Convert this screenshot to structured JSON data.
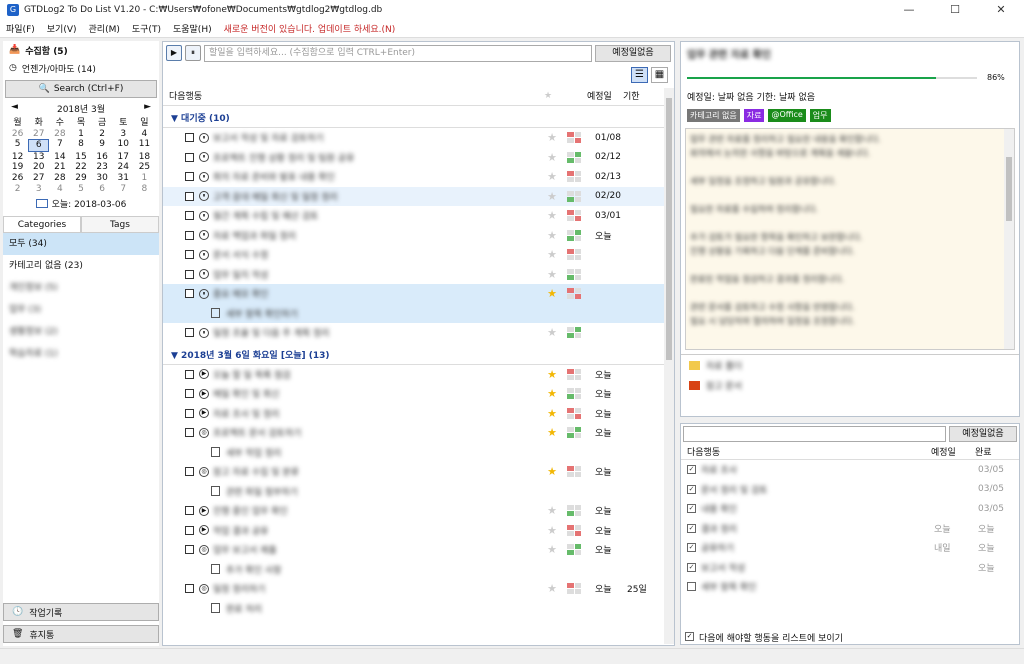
{
  "window": {
    "title": "GTDLog2 To Do List V1.20 - C:₩Users₩ofone₩Documents₩gtdlog2₩gtdlog.db",
    "min": "—",
    "max": "☐",
    "close": "✕"
  },
  "menu": [
    "파일(F)",
    "보기(V)",
    "관리(M)",
    "도구(T)",
    "도움말(H)"
  ],
  "menu_update": "새로운 버전이 있습니다. 업데이트 하세요.(N)",
  "left": {
    "inbox": "수집함 (5)",
    "someday": "언젠가/아마도 (14)",
    "search": "Search (Ctrl+F)",
    "calendar": {
      "title": "2018년 3월",
      "prev": "◄",
      "next": "►",
      "weekdays": [
        "월",
        "화",
        "수",
        "목",
        "금",
        "토",
        "일"
      ],
      "days": [
        [
          "26",
          1
        ],
        [
          "27",
          1
        ],
        [
          "28",
          1
        ],
        [
          "1",
          0
        ],
        [
          "2",
          0
        ],
        [
          "3",
          0
        ],
        [
          "4",
          0
        ],
        [
          "5",
          0
        ],
        [
          "6",
          2
        ],
        [
          "7",
          0
        ],
        [
          "8",
          0
        ],
        [
          "9",
          0
        ],
        [
          "10",
          0
        ],
        [
          "11",
          0
        ],
        [
          "12",
          0
        ],
        [
          "13",
          0
        ],
        [
          "14",
          0
        ],
        [
          "15",
          0
        ],
        [
          "16",
          0
        ],
        [
          "17",
          0
        ],
        [
          "18",
          0
        ],
        [
          "19",
          0
        ],
        [
          "20",
          0
        ],
        [
          "21",
          0
        ],
        [
          "22",
          0
        ],
        [
          "23",
          0
        ],
        [
          "24",
          0
        ],
        [
          "25",
          0
        ],
        [
          "26",
          0
        ],
        [
          "27",
          0
        ],
        [
          "28",
          0
        ],
        [
          "29",
          0
        ],
        [
          "30",
          0
        ],
        [
          "31",
          0
        ],
        [
          "1",
          1
        ],
        [
          "2",
          1
        ],
        [
          "3",
          1
        ],
        [
          "4",
          1
        ],
        [
          "5",
          1
        ],
        [
          "6",
          1
        ],
        [
          "7",
          1
        ],
        [
          "8",
          1
        ]
      ],
      "today": "오늘: 2018-03-06"
    },
    "tabs": [
      "Categories",
      "Tags"
    ],
    "categories": [
      "모두 (34)",
      "카테고리 없음 (23)",
      "개인정보 (5)",
      "업무 (3)",
      "생활정보 (2)",
      "학습자료 (1)"
    ],
    "history": "작업기록",
    "trash": "휴지통"
  },
  "mid": {
    "placeholder": "할일을 입력하세요... (수집함으로 입력 CTRL+Enter)",
    "schedule_btn": "예정일없음",
    "play_icon": "▶",
    "pause_icon": "⏸",
    "list_icon": "☰",
    "grid_icon": "▦",
    "headers": {
      "next": "다음행동",
      "star": "★",
      "due": "예정일",
      "limit": "기한"
    },
    "group1": "▼ 대기중 (10)",
    "group2": "▼ 2018년 3월 6일 화요일 [오늘] (13)",
    "rows1": [
      {
        "t": "보고서 작성 및 자료 검토하기",
        "s": "⏸",
        "star": 0,
        "due": "01/08",
        "lim": "",
        "cls": ""
      },
      {
        "t": "프로젝트 진행 상황 정리 및 팀원 공유",
        "s": "⏸",
        "star": 0,
        "due": "02/12",
        "lim": "",
        "cls": ""
      },
      {
        "t": "회의 자료 준비와 발표 내용 확인",
        "s": "⏸",
        "star": 0,
        "due": "02/13",
        "lim": "",
        "cls": ""
      },
      {
        "t": "고객 응대 메일 회신 및 일정 정리",
        "s": "⏸",
        "star": 0,
        "due": "02/20",
        "lim": "",
        "cls": "hl"
      },
      {
        "t": "월간 계획 수립 및 예산 검토",
        "s": "⏸",
        "star": 0,
        "due": "03/01",
        "lim": "",
        "cls": ""
      },
      {
        "t": "자료 백업과 파일 정리",
        "s": "⏸",
        "star": 0,
        "due": "오늘",
        "lim": "",
        "cls": ""
      },
      {
        "t": "문서 서식 수정",
        "s": "⏸",
        "star": 0,
        "due": "",
        "lim": "",
        "cls": ""
      },
      {
        "t": "업무 일지 작성",
        "s": "⏸",
        "star": 0,
        "due": "",
        "lim": "",
        "cls": ""
      },
      {
        "t": "중요 메모 확인",
        "s": "⏸",
        "star": 1,
        "due": "",
        "lim": "",
        "cls": "sel"
      }
    ],
    "sub1": "세부 항목 확인하기",
    "row1b": {
      "t": "일정 조율 및 다음 주 계획 정리",
      "s": "⏸",
      "star": 0,
      "due": "",
      "lim": ""
    },
    "rows2": [
      {
        "t": "오늘 할 일 목록 점검",
        "s": "▶",
        "star": 1,
        "due": "오늘",
        "lim": ""
      },
      {
        "t": "메일 확인 및 회신",
        "s": "▶",
        "star": 1,
        "due": "오늘",
        "lim": ""
      },
      {
        "t": "자료 조사 및 정리",
        "s": "▶",
        "star": 1,
        "due": "오늘",
        "lim": ""
      },
      {
        "t": "프로젝트 문서 검토하기",
        "s": "◎",
        "star": 1,
        "due": "오늘",
        "lim": ""
      }
    ],
    "sub2a": "세부 작업 정리",
    "row2b": {
      "t": "참고 자료 수집 및 분류",
      "s": "◎",
      "star": 1,
      "due": "오늘",
      "lim": ""
    },
    "sub2b": "관련 파일 첨부하기",
    "rows3": [
      {
        "t": "진행 중인 업무 확인",
        "s": "▶",
        "star": 0,
        "due": "오늘",
        "lim": ""
      },
      {
        "t": "작업 결과 공유",
        "s": "▶",
        "star": 0,
        "due": "오늘",
        "lim": ""
      },
      {
        "t": "업무 보고서 제출",
        "s": "◎",
        "star": 0,
        "due": "오늘",
        "lim": ""
      }
    ],
    "sub3a": "추가 확인 사항",
    "row3b": {
      "t": "일정 정리하기",
      "s": "◎",
      "star": 0,
      "due": "오늘",
      "lim": "25일"
    },
    "sub3b": "완료 처리"
  },
  "right": {
    "title": "업무 관련 자료 확인",
    "progress_pct": 0.86,
    "progress_label": "86%",
    "dates": "예정일: 날짜 없음      기한: 날짜 없음",
    "tags": [
      {
        "t": "카테고리 없음",
        "c": "#777777"
      },
      {
        "t": "자료",
        "c": "#8a2be2"
      },
      {
        "t": "@Office",
        "c": "#1a8c1a"
      },
      {
        "t": "업무",
        "c": "#1a8c1a"
      }
    ],
    "note": [
      "업무 관련 자료를 정리하고 필요한 내용을 확인합니다.",
      "회의에서 논의한 사항을 바탕으로 계획을 세웁니다.",
      "",
      "세부 일정을 조정하고 팀원과 공유합니다.",
      "",
      "필요한 자료를 수집하여 정리합니다.",
      "",
      "추가 검토가 필요한 항목을 확인하고 보완합니다.",
      "진행 상황을 기록하고 다음 단계를 준비합니다.",
      "",
      "완료된 작업을 점검하고 결과를 정리합니다.",
      "",
      "관련 문서를 검토하고 수정 사항을 반영합니다.",
      "필요 시 담당자와 협의하여 일정을 조정합니다."
    ],
    "files": [
      "자료 폴더",
      "참고 문서"
    ],
    "sub_btn": "예정일없음",
    "sub_headers": {
      "next": "다음행동",
      "due": "예정일",
      "done": "완료"
    },
    "subtasks": [
      {
        "t": "자료 조사",
        "due": "",
        "done": "03/05",
        "c": 1
      },
      {
        "t": "문서 정리 및 검토",
        "due": "",
        "done": "03/05",
        "c": 1
      },
      {
        "t": "내용 확인",
        "due": "",
        "done": "03/05",
        "c": 1
      },
      {
        "t": "결과 정리",
        "due": "오늘",
        "done": "오늘",
        "c": 1
      },
      {
        "t": "공유하기",
        "due": "내일",
        "done": "오늘",
        "c": 1
      },
      {
        "t": "보고서 작성",
        "due": "",
        "done": "오늘",
        "c": 1
      },
      {
        "t": "세부 항목 확인",
        "due": "",
        "done": "",
        "c": 0
      }
    ],
    "footer": "다음에 해야할 행동을 리스트에 보이기"
  }
}
